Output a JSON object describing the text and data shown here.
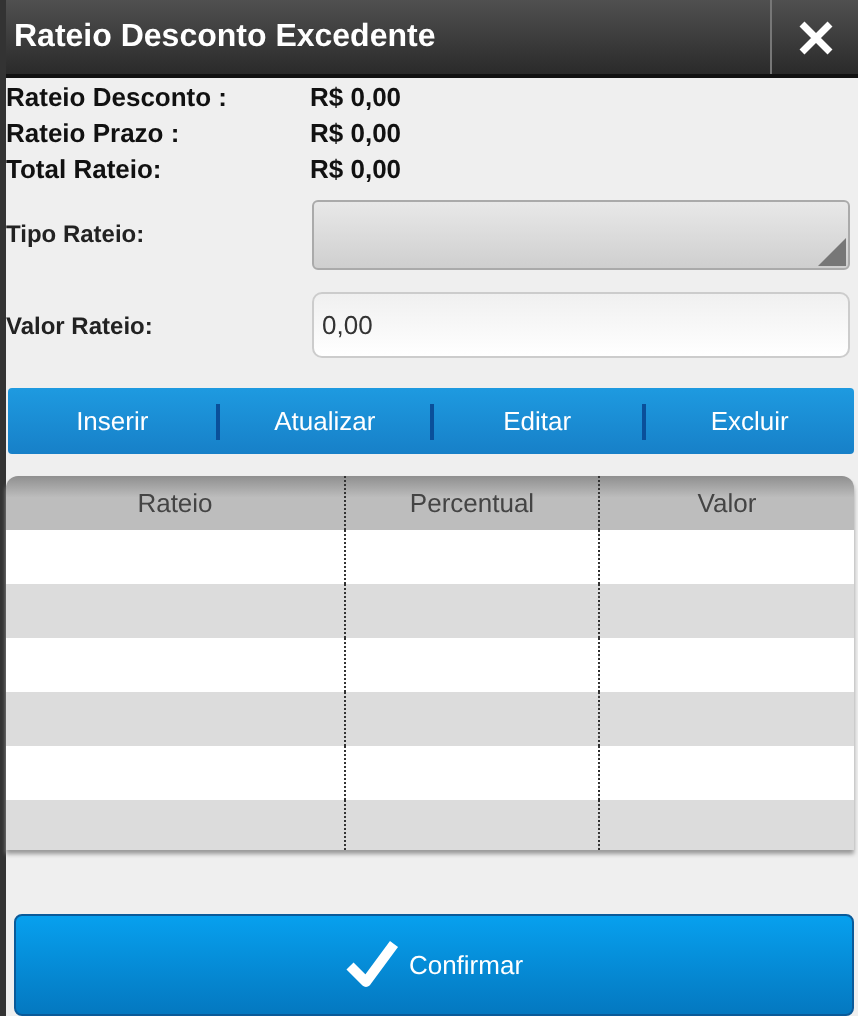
{
  "window": {
    "title": "Rateio Desconto Excedente"
  },
  "summary": [
    {
      "label": "Rateio Desconto :",
      "value": "R$ 0,00"
    },
    {
      "label": "Rateio Prazo :",
      "value": "R$ 0,00"
    },
    {
      "label": "Total Rateio:",
      "value": "R$ 0,00"
    }
  ],
  "fields": [
    {
      "kind": "dropdown",
      "label": "Tipo Rateio:"
    },
    {
      "kind": "input",
      "label": "Valor Rateio:",
      "value": "0,00"
    }
  ],
  "toolbar": [
    "Inserir",
    "Atualizar",
    "Editar",
    "Excluir"
  ],
  "table": {
    "columns": [
      "Rateio",
      "Percentual",
      "Valor"
    ]
  },
  "confirm_button": "Confirmar"
}
